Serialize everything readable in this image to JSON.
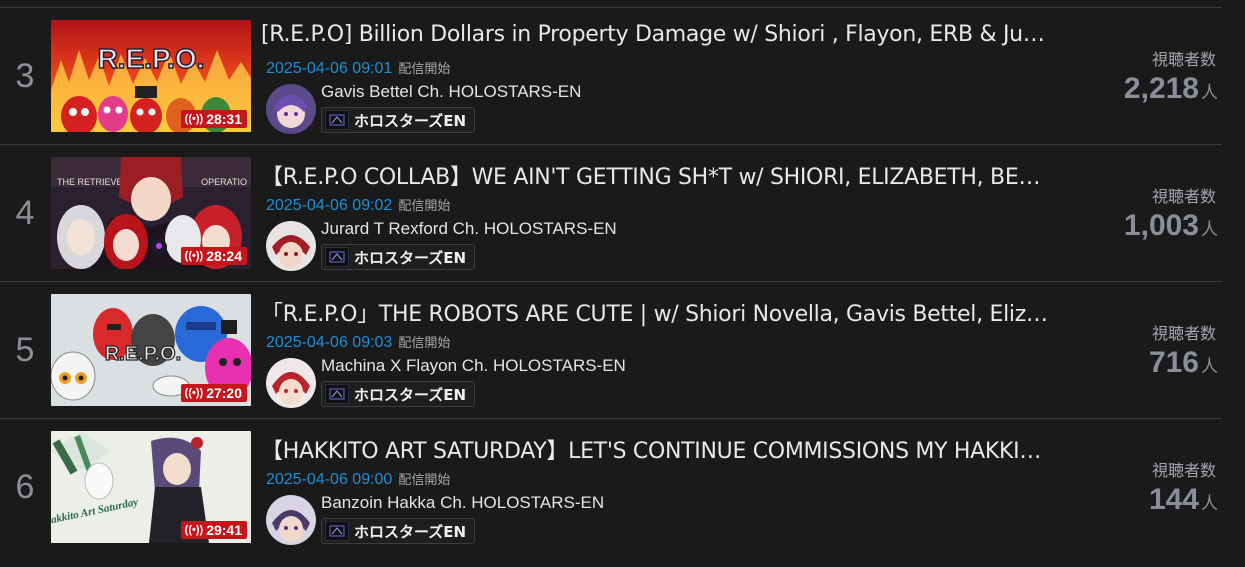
{
  "streams": [
    {
      "rank": "3",
      "title": "[R.E.P.O] Billion Dollars in Property Damage w/ Shiori , Flayon, ERB & Jurard",
      "time": "2025-04-06 09:01",
      "status": "配信開始",
      "channel": "Gavis Bettel Ch. HOLOSTARS-EN",
      "tag": "ホロスターズEN",
      "duration": "28:31",
      "viewers_label": "視聴者数",
      "viewers": "2,218",
      "unit": "人",
      "thumb_icon": "repo-fire-thumbnail",
      "thumb_text": "R.E.P.O."
    },
    {
      "rank": "4",
      "title": "【R.E.P.O COLLAB】WE AIN'T GETTING SH*T w/ SHIORI, ELIZABETH, BETT…",
      "time": "2025-04-06 09:02",
      "status": "配信開始",
      "channel": "Jurard T Rexford Ch. HOLOSTARS-EN",
      "tag": "ホロスターズEN",
      "duration": "28:24",
      "viewers_label": "視聴者数",
      "viewers": "1,003",
      "unit": "人",
      "thumb_icon": "repo-collab-thumbnail",
      "thumb_text_left": "THE RETRIEVE",
      "thumb_text_right": "OPERATIO"
    },
    {
      "rank": "5",
      "title": "「R.E.P.O」THE ROBOTS ARE CUTE | w/ Shiori Novella, Gavis Bettel, Elizab…",
      "time": "2025-04-06 09:03",
      "status": "配信開始",
      "channel": "Machina X Flayon Ch. HOLOSTARS-EN",
      "tag": "ホロスターズEN",
      "duration": "27:20",
      "viewers_label": "視聴者数",
      "viewers": "716",
      "unit": "人",
      "thumb_icon": "repo-robots-thumbnail",
      "thumb_text": "R.E.P.O."
    },
    {
      "rank": "6",
      "title": "【HAKKITO ART SATURDAY】LET'S CONTINUE COMMISSIONS MY HAKKIT…",
      "time": "2025-04-06 09:00",
      "status": "配信開始",
      "channel": "Banzoin Hakka Ch. HOLOSTARS-EN",
      "tag": "ホロスターズEN",
      "duration": "29:41",
      "viewers_label": "視聴者数",
      "viewers": "144",
      "unit": "人",
      "thumb_icon": "hakkito-art-thumbnail",
      "thumb_text": "Hakkito Art Saturday"
    }
  ],
  "colors": {
    "background": "#1a1a1b",
    "time": "#1f8ed6",
    "live_badge": "#c4161c",
    "divider": "#3a3a3c"
  }
}
